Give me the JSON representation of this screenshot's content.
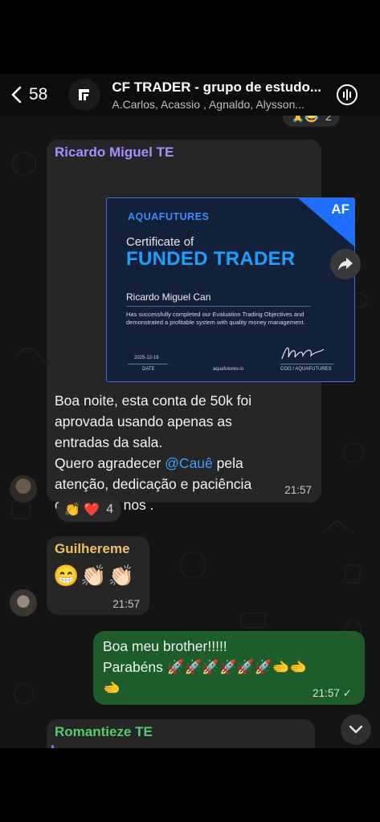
{
  "header": {
    "back_count": "58",
    "title": "CF TRADER - grupo de estudo...",
    "members": "A.Carlos, Acassio , Agnaldo, Alysson..."
  },
  "messages": [
    {
      "sender": "Ricardo Miguel TE",
      "sender_color": "#a98cff",
      "certificate": {
        "brand": "AQUAFUTURES",
        "badge": "AF",
        "title_small": "Certificate of",
        "title_big": "FUNDED TRADER",
        "name": "Ricardo Miguel Can",
        "description": "Has successfully completed our Evaluation Trading Objectives and demonstrated a profitable system with quality money management.",
        "date_value": "2025-12-16",
        "date_label": "DATE",
        "site": "aquafutures.io",
        "coo_label": "COO / AQUAFUTURES"
      },
      "text_lines": [
        "Boa noite, esta conta de 50k foi",
        "aprovada usando apenas as",
        "entradas da sala.",
        "Quero agradecer ",
        "atenção, dedicação e paciência",
        "com todos nos ."
      ],
      "mention": "@Cauê",
      "mention_suffix": " pela",
      "time": "21:57",
      "reactions": {
        "emojis": "👏 ❤️",
        "count": "4"
      }
    },
    {
      "sender": "Guilhereme",
      "sender_color": "#f0c060",
      "text": "😁👏🏻👏🏻",
      "time": "21:57"
    },
    {
      "text_lines": [
        "Boa meu brother!!!!!",
        "Parabéns 🚀🚀🚀🚀🚀🚀🫲🫲",
        "🫲"
      ],
      "time": "21:57 ✓"
    },
    {
      "sender": "Romantieze TE",
      "sender_color": "#4ccf6a"
    }
  ],
  "colors": {
    "header_bg": "#0d0d0d",
    "incoming_bubble": "#262626",
    "outgoing_bubble": "#1d5c2b",
    "mention": "#37a3ff",
    "accent_blue": "#1aa0ff"
  },
  "icons": [
    "back-chevron-icon",
    "group-logo-icon",
    "voice-call-icon",
    "forward-icon",
    "chevron-down-icon"
  ]
}
